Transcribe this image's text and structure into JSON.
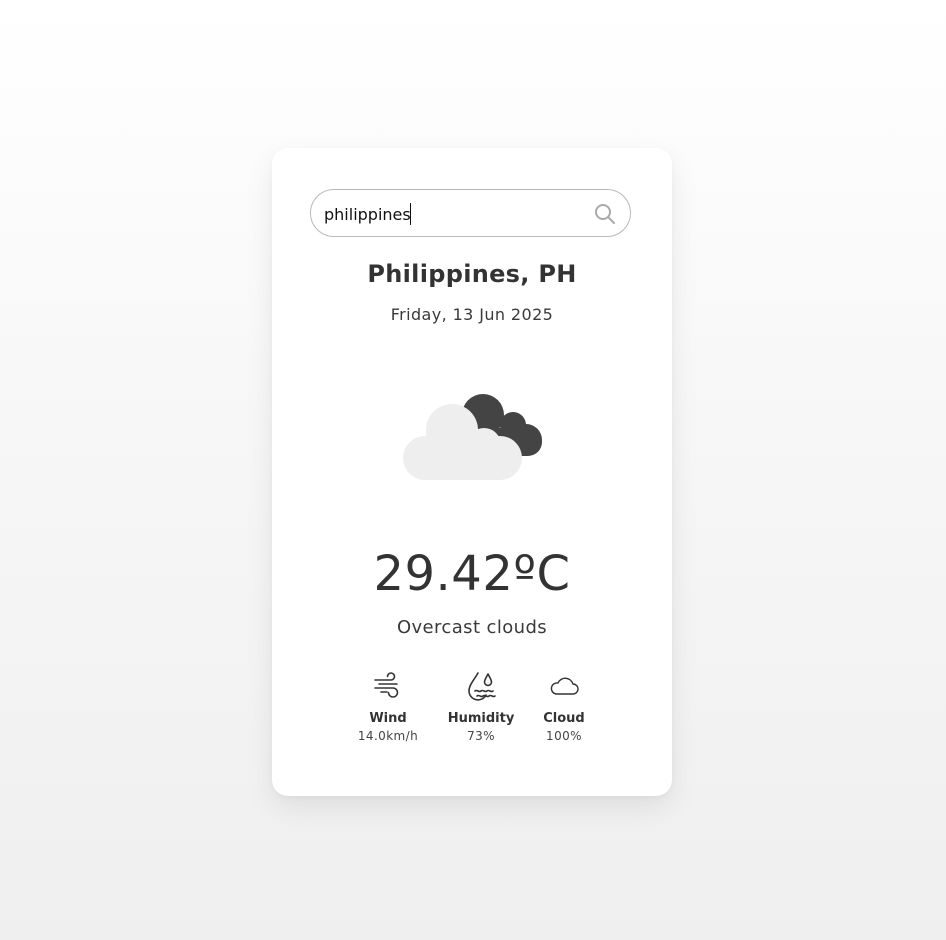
{
  "search": {
    "value": "philippines",
    "icon": "search-icon"
  },
  "location": {
    "name": "Philippines, PH",
    "date": "Friday, 13 Jun 2025"
  },
  "weather": {
    "icon": "overcast-clouds-icon",
    "temperature": "29.42ºC",
    "description": "Overcast clouds"
  },
  "stats": {
    "wind": {
      "icon": "wind-icon",
      "label": "Wind",
      "value": "14.0km/h"
    },
    "humidity": {
      "icon": "humidity-icon",
      "label": "Humidity",
      "value": "73%"
    },
    "cloud": {
      "icon": "cloud-icon",
      "label": "Cloud",
      "value": "100%"
    }
  },
  "colors": {
    "card": "#ffffff",
    "text": "#333333",
    "cloud_light": "#eeeeee",
    "cloud_dark": "#444444",
    "border": "#b9b9b9"
  }
}
